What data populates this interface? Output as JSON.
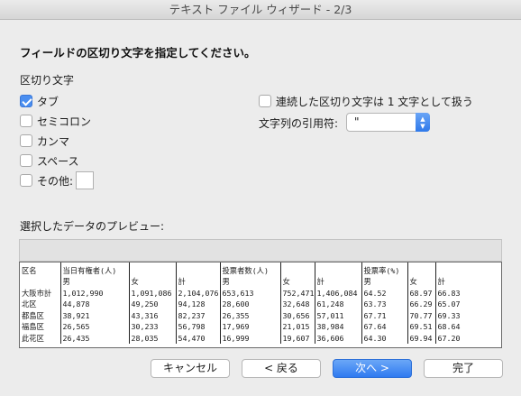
{
  "window": {
    "title": "テキスト ファイル ウィザード - 2/3"
  },
  "heading": "フィールドの区切り文字を指定してください。",
  "delimiters": {
    "label": "区切り文字",
    "tab": {
      "label": "タブ",
      "checked": true
    },
    "semicolon": {
      "label": "セミコロン",
      "checked": false
    },
    "comma": {
      "label": "カンマ",
      "checked": false
    },
    "space": {
      "label": "スペース",
      "checked": false
    },
    "other": {
      "label": "その他:",
      "checked": false,
      "value": ""
    }
  },
  "options": {
    "consecutive": {
      "label": "連続した区切り文字は 1 文字として扱う",
      "checked": false
    },
    "text_qualifier": {
      "label": "文字列の引用符:",
      "value": "\""
    }
  },
  "preview": {
    "label": "選択したデータのプレビュー:",
    "rows": [
      [
        "区名",
        "当日有権者(人)",
        "",
        "",
        "投票者数(人)",
        "",
        "",
        "投票率(%)",
        "",
        ""
      ],
      [
        "",
        "男",
        "女",
        "計",
        "男",
        "女",
        "計",
        "男",
        "女",
        "計"
      ],
      [
        "大阪市計",
        "1,012,990",
        "1,091,086",
        "2,104,076",
        "653,613",
        "752,471",
        "1,406,084",
        "64.52",
        "68.97",
        "66.83"
      ],
      [
        "北区",
        "44,878",
        "49,250",
        "94,128",
        "28,600",
        "32,648",
        "61,248",
        "63.73",
        "66.29",
        "65.07"
      ],
      [
        "都島区",
        "38,921",
        "43,316",
        "82,237",
        "26,355",
        "30,656",
        "57,011",
        "67.71",
        "70.77",
        "69.33"
      ],
      [
        "福島区",
        "26,565",
        "30,233",
        "56,798",
        "17,969",
        "21,015",
        "38,984",
        "67.64",
        "69.51",
        "68.64"
      ],
      [
        "此花区",
        "26,435",
        "28,035",
        "54,470",
        "16,999",
        "19,607",
        "36,606",
        "64.30",
        "69.94",
        "67.20"
      ]
    ]
  },
  "buttons": {
    "cancel": "キャンセル",
    "back": "< 戻る",
    "next": "次へ >",
    "finish": "完了"
  },
  "colors": {
    "accent": "#3b82f0",
    "background": "#ececec"
  }
}
